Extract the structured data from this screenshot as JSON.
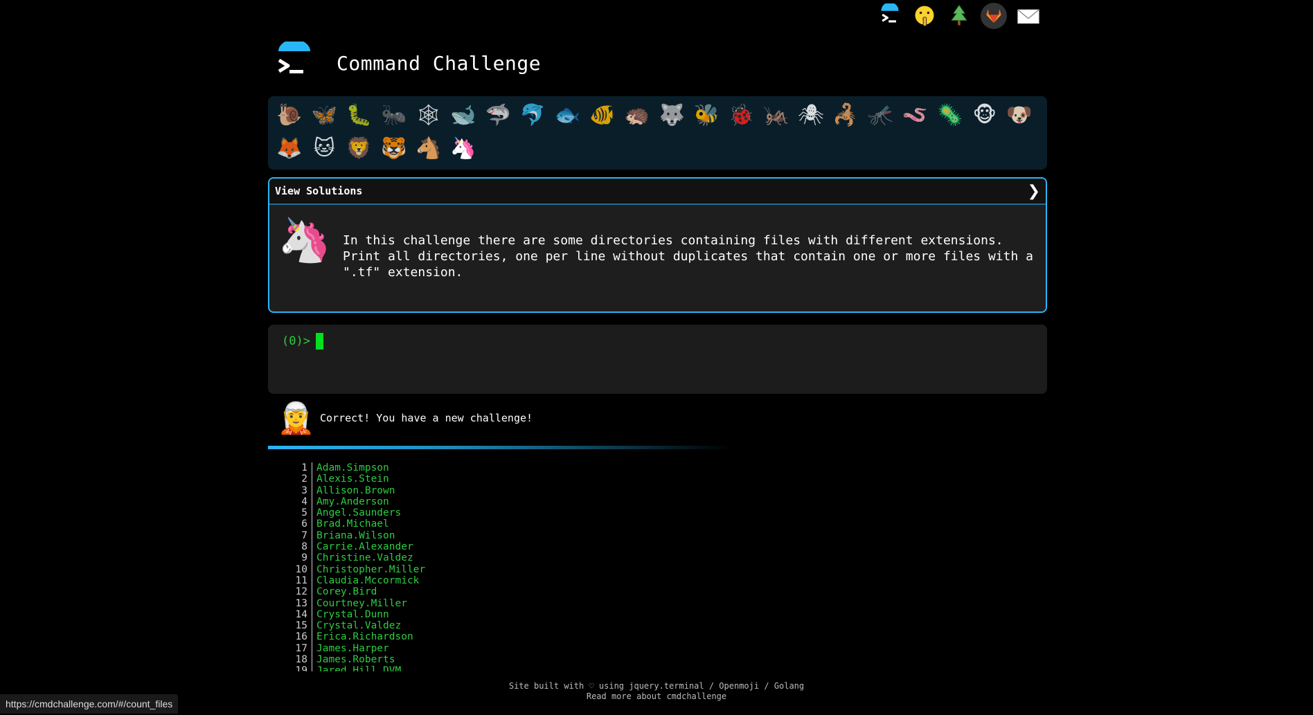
{
  "topnav": {
    "icons": [
      "terminal-logo-icon",
      "shushing-face-icon",
      "evergreen-tree-icon",
      "gitlab-icon",
      "envelope-icon"
    ]
  },
  "header": {
    "title": "Command Challenge"
  },
  "challenges": {
    "row1": [
      "🐌",
      "🦋",
      "🐛",
      "🐜",
      "🕸",
      "🐋",
      "🦈",
      "🐬",
      "🐟",
      "🐠",
      "🦔",
      "🐺",
      "🐝",
      "🐞",
      "🦗",
      "🕷",
      "🦂",
      "🦟",
      "🪱",
      "🦠",
      "🐵",
      "🐶"
    ],
    "row2": [
      "🦊",
      "🐱",
      "🦁",
      "🐯",
      "🐴",
      "🦄"
    ]
  },
  "panel": {
    "head_label": "View Solutions",
    "chevron": "❯",
    "avatar": "🦄",
    "description": "In this challenge there are some directories containing files with different extensions. Print all directories, one per line without duplicates that contain one or more files with a \".tf\" extension."
  },
  "terminal": {
    "prompt_open": "(",
    "prompt_num": "0",
    "prompt_close": ")>"
  },
  "result": {
    "avatar": "🧝",
    "message": "Correct! You have a new challenge!"
  },
  "output": [
    "Adam.Simpson",
    "Alexis.Stein",
    "Allison.Brown",
    "Amy.Anderson",
    "Angel.Saunders",
    "Brad.Michael",
    "Briana.Wilson",
    "Carrie.Alexander",
    "Christine.Valdez",
    "Christopher.Miller",
    "Claudia.Mccormick",
    "Corey.Bird",
    "Courtney.Miller",
    "Crystal.Dunn",
    "Crystal.Valdez",
    "Erica.Richardson",
    "James.Harper",
    "James.Roberts",
    "Jared.Hill.DVM"
  ],
  "footer": {
    "line1": "Site built with ♡ using jquery.terminal / Openmoji / Golang",
    "line2": "Read more about cmdchallenge"
  },
  "status_url": "https://cmdchallenge.com/#/count_files",
  "colors": {
    "accent": "#29b6f6",
    "prompt_green": "#2ecc40",
    "panel_bg": "#0a1e2a"
  }
}
